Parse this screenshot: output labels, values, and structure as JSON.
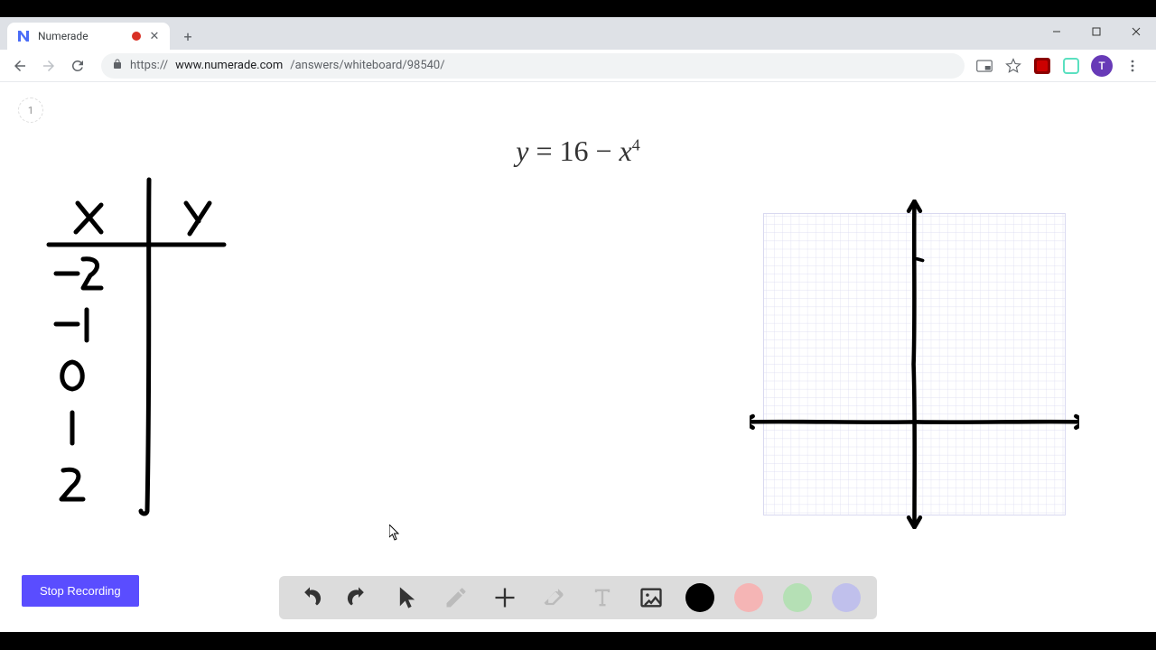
{
  "tab": {
    "title": "Numerade",
    "recording": true
  },
  "url": {
    "scheme": "https://",
    "host": "www.numerade.com",
    "path": "/answers/whiteboard/98540/"
  },
  "avatar_initial": "T",
  "page_number": "1",
  "equation": {
    "lhs": "y",
    "eq": " = ",
    "rhs_a": "16 − ",
    "rhs_var": "x",
    "rhs_exp": "4"
  },
  "table": {
    "header_x": "x",
    "header_y": "y",
    "x_values": [
      "-2",
      "-1",
      "0",
      "1",
      "2"
    ]
  },
  "buttons": {
    "stop_recording": "Stop Recording"
  },
  "toolbar": {
    "undo": "undo",
    "redo": "redo",
    "pointer": "pointer",
    "pencil": "pencil",
    "add": "add",
    "eraser": "eraser",
    "text": "text",
    "image": "image"
  },
  "colors": {
    "black": "#000000",
    "pink": "#f5b5b5",
    "green": "#b5e0b5",
    "purple": "#c0c0ec"
  },
  "grid": {
    "color": "#d6d6f0"
  }
}
